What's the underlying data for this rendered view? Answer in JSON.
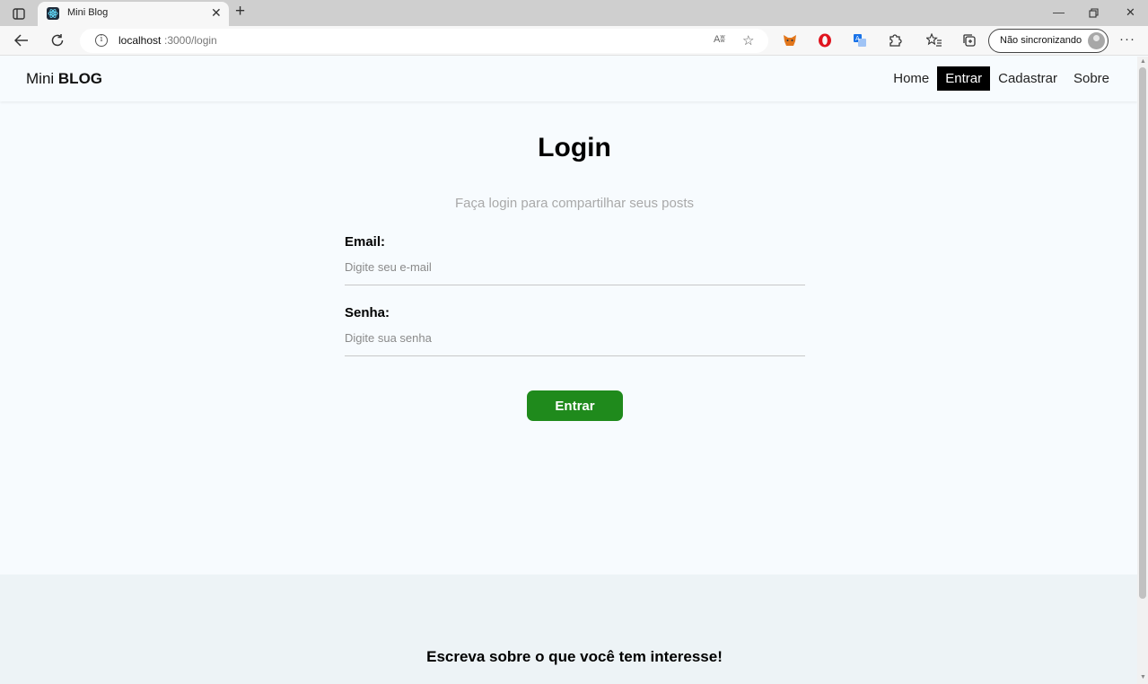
{
  "browser": {
    "tab_title": "Mini Blog",
    "url_host": "localhost",
    "url_path": ":3000/login",
    "sync_label": "Não sincronizando",
    "read_aloud_glyph": "Aʬ",
    "icons": [
      "tab-actions-icon",
      "react-favicon-icon",
      "close-icon",
      "plus-icon",
      "minimize-icon",
      "restore-icon",
      "back-arrow-icon",
      "reload-icon",
      "info-icon",
      "read-aloud-icon",
      "add-favorite-icon",
      "metamask-icon",
      "opera-icon",
      "translate-icon",
      "extensions-icon",
      "favorites-icon",
      "collections-icon",
      "profile-avatar-icon",
      "more-icon"
    ]
  },
  "navbar": {
    "brand_prefix": "Mini",
    "brand_bold": "BLOG",
    "links": [
      {
        "label": "Home"
      },
      {
        "label": "Entrar"
      },
      {
        "label": "Cadastrar"
      },
      {
        "label": "Sobre"
      }
    ],
    "active_link": "Entrar"
  },
  "login": {
    "title": "Login",
    "subtitle": "Faça login para compartilhar seus posts",
    "email_label": "Email:",
    "email_placeholder": "Digite seu e-mail",
    "password_label": "Senha:",
    "password_placeholder": "Digite sua senha",
    "submit_label": "Entrar"
  },
  "footer": {
    "text": "Escreva sobre o que você tem interesse!"
  },
  "colors": {
    "accent_green": "#1f8a1c",
    "active_nav_bg": "#000000",
    "page_bg": "#f7fbfe",
    "footer_bg": "#edf3f6"
  }
}
